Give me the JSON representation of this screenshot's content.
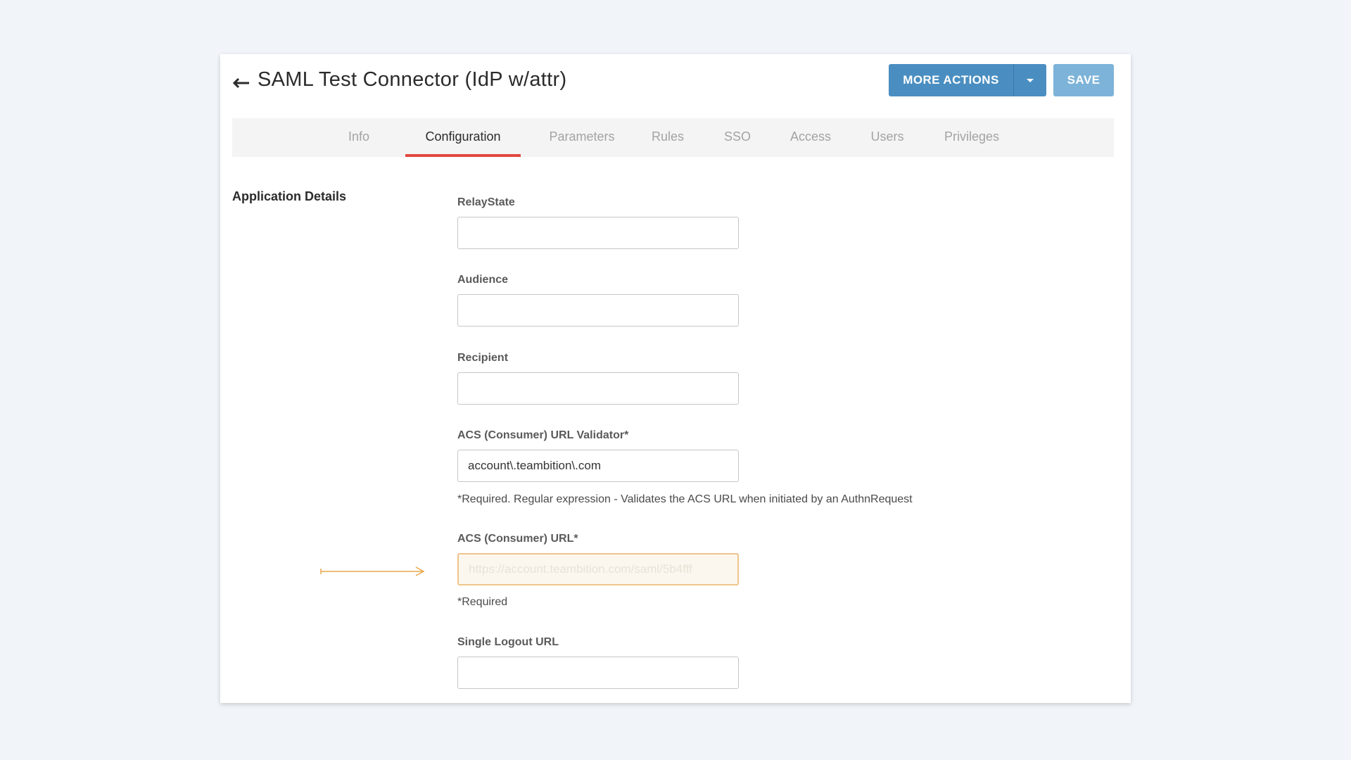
{
  "header": {
    "back_icon": "left-arrow-icon",
    "title": "SAML Test Connector (IdP w/attr)",
    "more_actions_label": "MORE ACTIONS",
    "caret_icon": "caret-down-icon",
    "save_label": "SAVE"
  },
  "tabs": [
    {
      "label": "Info",
      "active": false
    },
    {
      "label": "Configuration",
      "active": true
    },
    {
      "label": "Parameters",
      "active": false
    },
    {
      "label": "Rules",
      "active": false
    },
    {
      "label": "SSO",
      "active": false
    },
    {
      "label": "Access",
      "active": false
    },
    {
      "label": "Users",
      "active": false
    },
    {
      "label": "Privileges",
      "active": false
    }
  ],
  "section": {
    "title": "Application Details"
  },
  "fields": {
    "relay_state": {
      "label": "RelayState",
      "value": ""
    },
    "audience": {
      "label": "Audience",
      "value": ""
    },
    "recipient": {
      "label": "Recipient",
      "value": ""
    },
    "acs_validator": {
      "label": "ACS (Consumer) URL Validator*",
      "value": "account\\.teambition\\.com",
      "helper": "*Required. Regular expression - Validates the ACS URL when initiated by an AuthnRequest"
    },
    "acs_url": {
      "label": "ACS (Consumer) URL*",
      "placeholder": "https://account.teambition.com/saml/5b4fff",
      "helper": "*Required"
    },
    "single_logout": {
      "label": "Single Logout URL",
      "value": ""
    }
  },
  "colors": {
    "primary_button": "#4a8ec1",
    "save_button": "#7db3d8",
    "active_tab_underline": "#e2473f",
    "highlight_border": "#efc48a",
    "annotation_arrow": "#e7a84c"
  },
  "annotation": {
    "arrow_icon": "annotation-arrow-icon"
  }
}
